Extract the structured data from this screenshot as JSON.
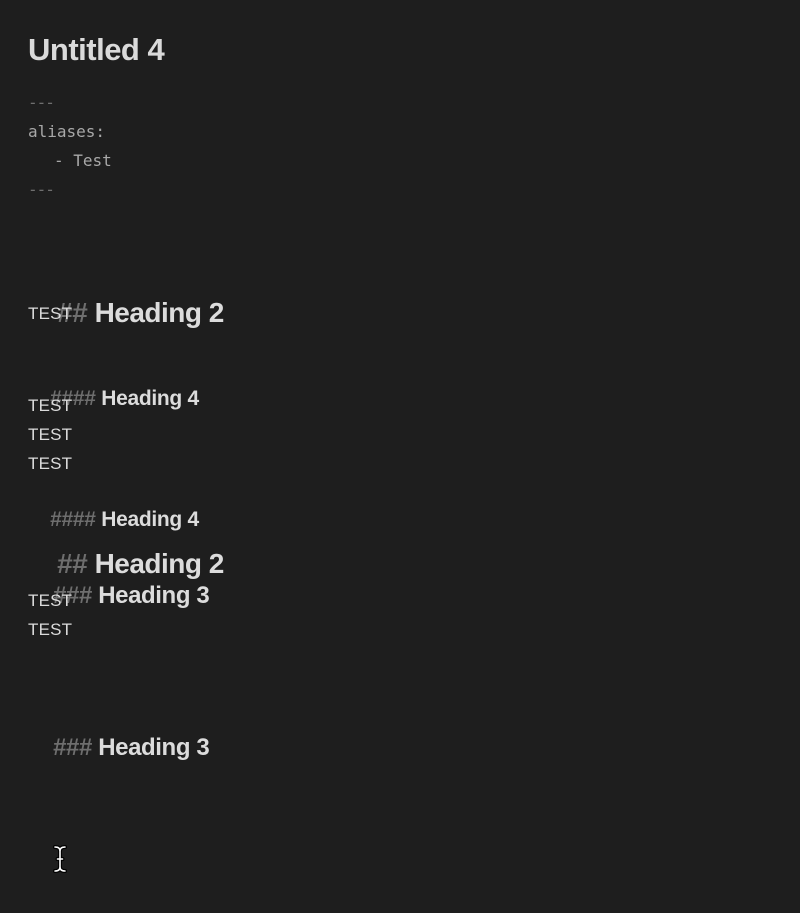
{
  "note": {
    "title": "Untitled 4",
    "frontmatter": {
      "open": "---",
      "key": "aliases:",
      "item": "- Test",
      "close": "---"
    },
    "blocks": [
      {
        "type": "heading",
        "hashes": "##",
        "text": "Heading 2"
      },
      {
        "type": "text",
        "text": "TEST"
      },
      {
        "type": "heading",
        "hashes": "####",
        "text": "Heading 4"
      },
      {
        "type": "text",
        "text": "TEST"
      },
      {
        "type": "text",
        "text": "TEST"
      },
      {
        "type": "text",
        "text": "TEST"
      },
      {
        "type": "heading",
        "hashes": "####",
        "text": "Heading 4"
      },
      {
        "type": "heading",
        "hashes": "##",
        "text": "Heading 2"
      },
      {
        "type": "heading",
        "hashes": "###",
        "text": "Heading 3"
      },
      {
        "type": "text",
        "text": "TEST"
      },
      {
        "type": "text",
        "text": "TEST"
      },
      {
        "type": "heading",
        "hashes": "###",
        "text": "Heading 3"
      }
    ]
  },
  "cursor": {
    "icon": "text-cursor-icon"
  },
  "colors": {
    "background": "#1e1e1e",
    "text": "#dcdcdc",
    "hash_marker": "#6e6e6e",
    "frontmatter": "#a8a8a8"
  }
}
